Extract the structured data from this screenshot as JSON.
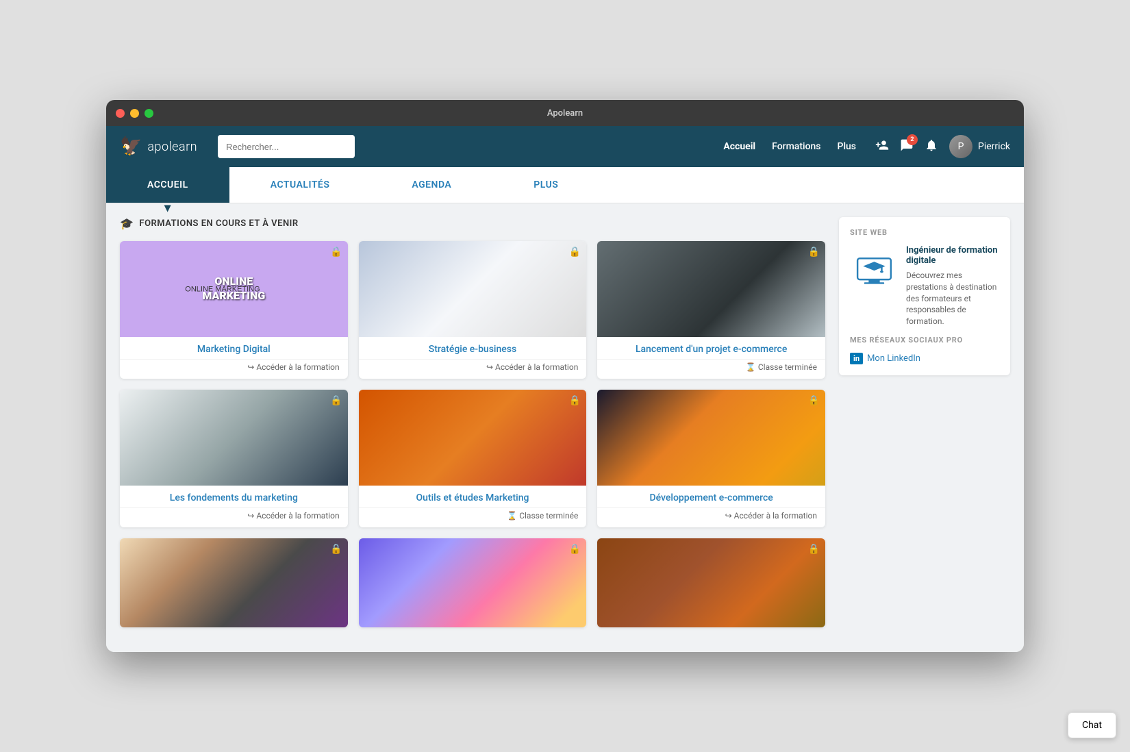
{
  "window": {
    "title": "Apolearn"
  },
  "titlebar": {
    "close": "●",
    "min": "●",
    "max": "●"
  },
  "nav": {
    "logo_text": "apolearn",
    "search_placeholder": "Rechercher...",
    "links": [
      {
        "id": "accueil",
        "label": "Accueil",
        "active": true
      },
      {
        "id": "formations",
        "label": "Formations",
        "active": false
      },
      {
        "id": "plus",
        "label": "Plus",
        "active": false
      }
    ],
    "user_name": "Pierrick",
    "badge_count": "2"
  },
  "sub_nav": {
    "tabs": [
      {
        "id": "accueil",
        "label": "ACCUEIL",
        "active": true
      },
      {
        "id": "actualites",
        "label": "ACTUALITÉS",
        "active": false
      },
      {
        "id": "agenda",
        "label": "AGENDA",
        "active": false
      },
      {
        "id": "plus",
        "label": "PLUS",
        "active": false
      }
    ]
  },
  "section": {
    "title": "FORMATIONS EN COURS ET À VENIR"
  },
  "courses": [
    {
      "id": "marketing-digital",
      "title": "Marketing Digital",
      "action": "Accéder à la formation",
      "action_icon": "↪",
      "terminated": false,
      "img_class": "img-marketing-digital",
      "img_text": "ONLINE MARKETING"
    },
    {
      "id": "strategie-e-business",
      "title": "Stratégie e-business",
      "action": "Accéder à la formation",
      "action_icon": "↪",
      "terminated": false,
      "img_class": "img-strategie",
      "img_text": ""
    },
    {
      "id": "lancement-ecommerce",
      "title": "Lancement d'un projet e-commerce",
      "action": "Classe terminée",
      "action_icon": "⌛",
      "terminated": true,
      "img_class": "img-lancement",
      "img_text": ""
    },
    {
      "id": "fondements-marketing",
      "title": "Les fondements du marketing",
      "action": "Accéder à la formation",
      "action_icon": "↪",
      "terminated": false,
      "img_class": "img-fondements",
      "img_text": ""
    },
    {
      "id": "outils-etudes",
      "title": "Outils et études Marketing",
      "action": "Classe terminée",
      "action_icon": "⌛",
      "terminated": true,
      "img_class": "img-outils",
      "img_text": ""
    },
    {
      "id": "developpement-ecommerce",
      "title": "Développement e-commerce",
      "action": "Accéder à la formation",
      "action_icon": "↪",
      "terminated": false,
      "img_class": "img-developpement",
      "img_text": ""
    },
    {
      "id": "row3-1",
      "title": "",
      "action": "",
      "action_icon": "",
      "terminated": false,
      "img_class": "img-row3-1",
      "img_text": ""
    },
    {
      "id": "row3-2",
      "title": "",
      "action": "",
      "action_icon": "",
      "terminated": false,
      "img_class": "img-row3-2",
      "img_text": ""
    },
    {
      "id": "row3-3",
      "title": "",
      "action": "",
      "action_icon": "",
      "terminated": false,
      "img_class": "img-row3-3",
      "img_text": ""
    }
  ],
  "sidebar": {
    "site_web_label": "SITE WEB",
    "site_title": "Ingénieur de formation digitale",
    "site_desc": "Découvrez mes prestations à destination des formateurs et responsables de formation.",
    "social_label": "MES RÉSEAUX SOCIAUX PRO",
    "linkedin_label": "Mon LinkedIn"
  },
  "chat": {
    "label": "Chat"
  }
}
